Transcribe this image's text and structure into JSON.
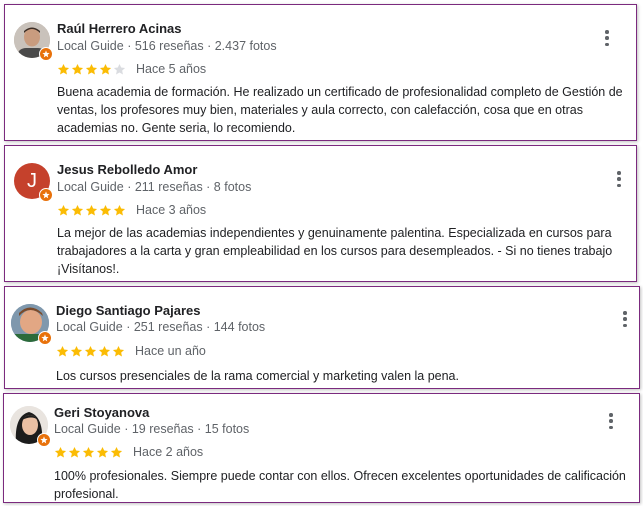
{
  "reviews": [
    {
      "name": "Raúl Herrero Acinas",
      "guide": "Local Guide",
      "stats": "516 reseñas · 2.437 fotos",
      "rating": 4,
      "ago": "Hace 5 años",
      "text": "Buena academia de formación. He realizado un certificado de profesionalidad completo de Gestión de ventas, los profesores muy bien, materiales y aula correcto, con calefacción, cosa que en otras academias no. Gente seria, lo recomiendo.",
      "avatar_icon": "person-photo-icon"
    },
    {
      "name": "Jesus Rebolledo Amor",
      "guide": "Local Guide",
      "stats": "211 reseñas · 8 fotos",
      "rating": 5,
      "ago": "Hace 3 años",
      "text": "La mejor de las academias independientes y genuinamente palentina. Especializada en cursos para trabajadores a la carta y gran empleabilidad en los cursos para desempleados. - Si no tienes trabajo ¡Visítanos!.",
      "avatar_letter": "J",
      "avatar_color": "#c5412c"
    },
    {
      "name": "Diego Santiago Pajares",
      "guide": "Local Guide",
      "stats": "251 reseñas · 144 fotos",
      "rating": 5,
      "ago": "Hace un año",
      "text": "Los cursos presenciales de la rama comercial y marketing valen la pena.",
      "avatar_icon": "person-photo-icon"
    },
    {
      "name": "Geri Stoyanova",
      "guide": "Local Guide",
      "stats": "19 reseñas · 15 fotos",
      "rating": 5,
      "ago": "Hace 2 años",
      "text": "100% profesionales. Siempre puede contar con ellos. Ofrecen excelentes oportunidades de calificación profesional.",
      "avatar_icon": "person-photo-icon"
    }
  ],
  "colors": {
    "star_filled": "#fbbc04",
    "star_empty": "#dadce0",
    "border": "#7b2a7e",
    "badge": "#e8710a"
  }
}
